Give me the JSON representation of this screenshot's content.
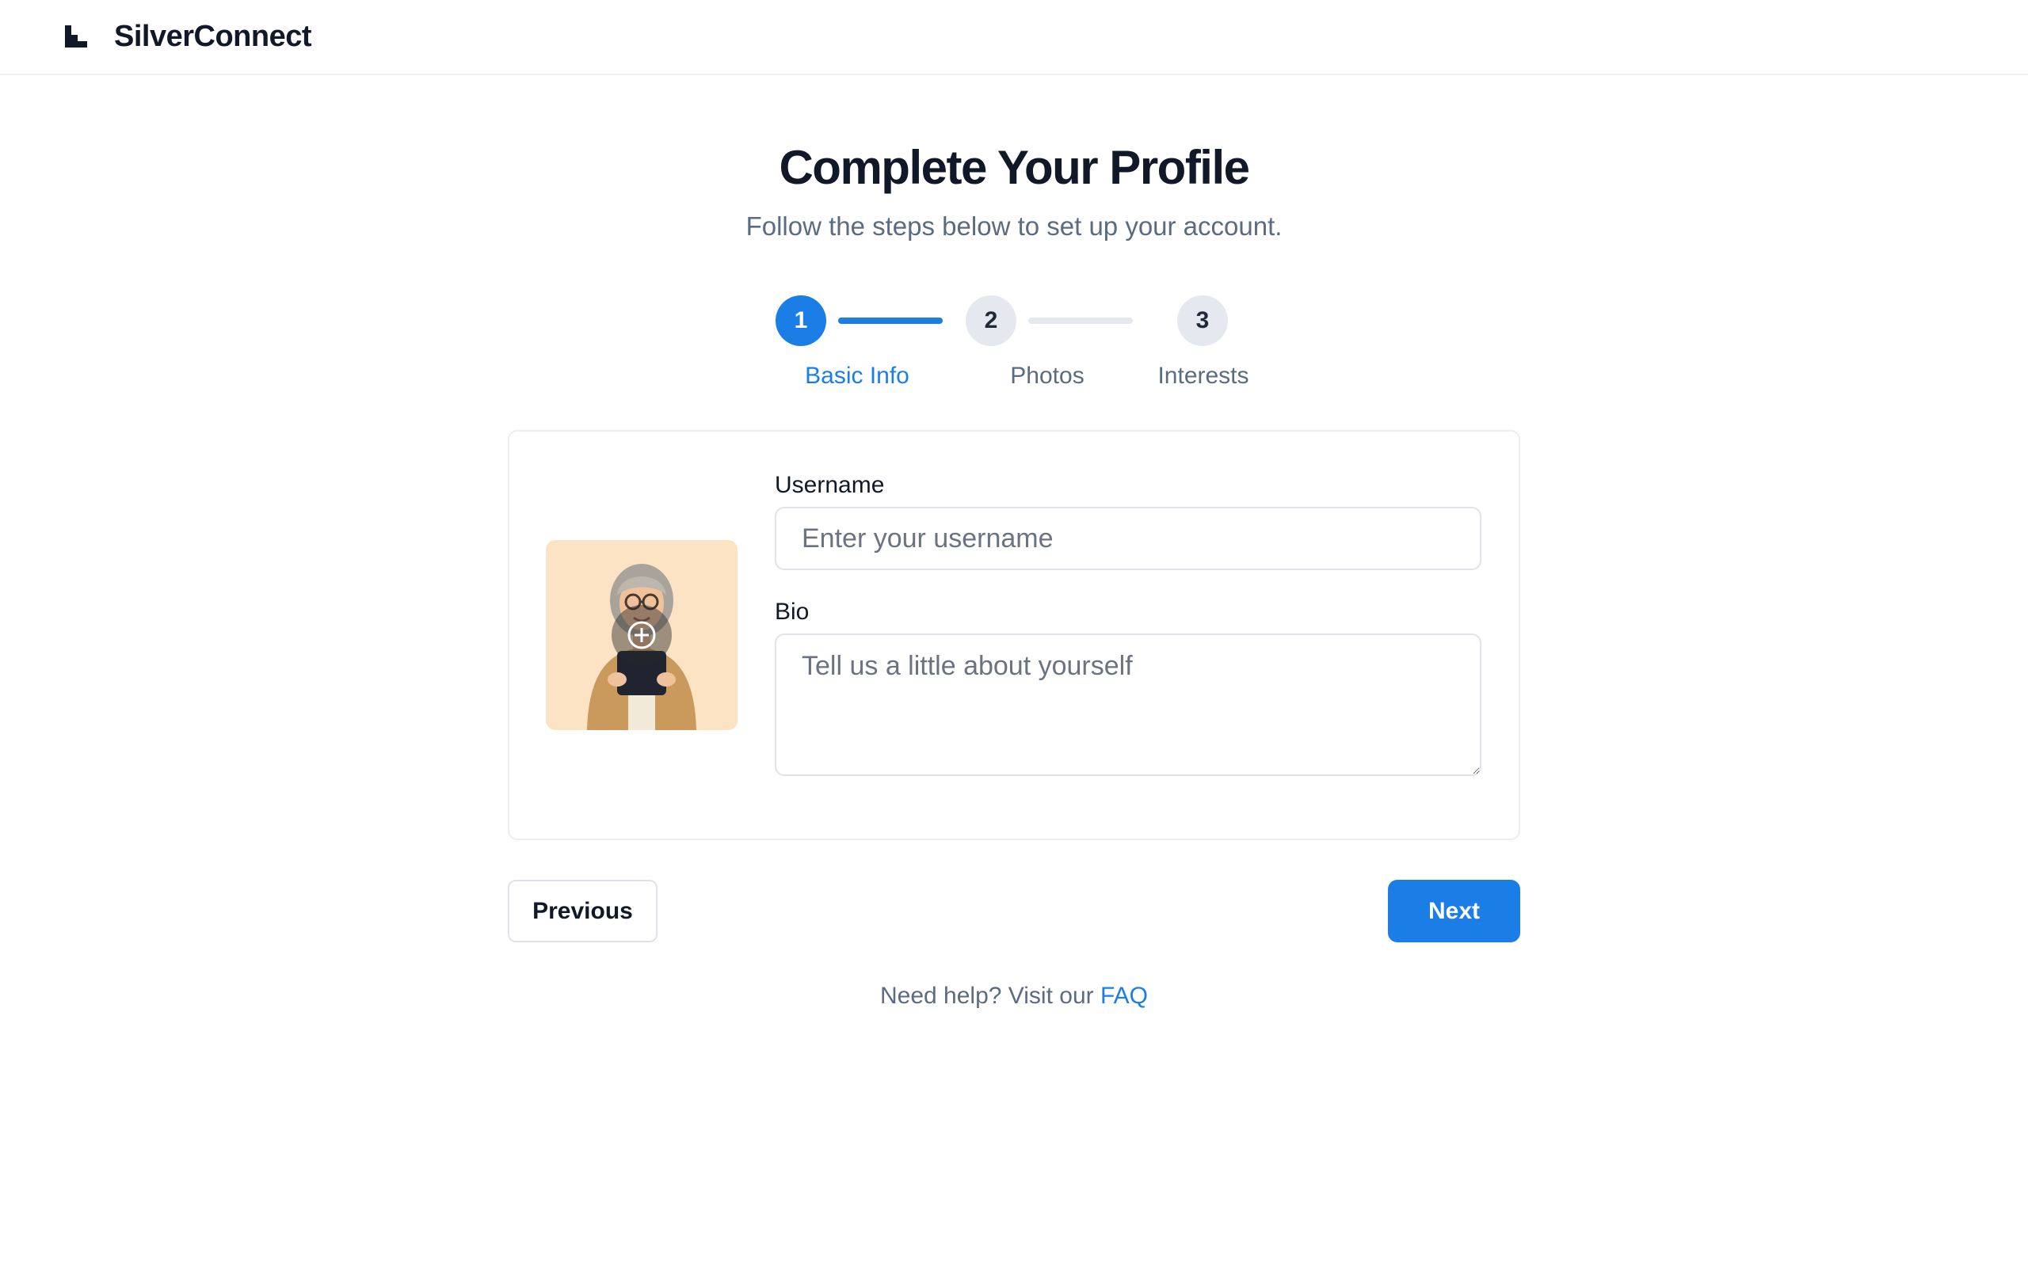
{
  "header": {
    "brand": "SilverConnect",
    "logo_icon": "brand-logo-icon"
  },
  "page": {
    "title": "Complete Your Profile",
    "subtitle": "Follow the steps below to set up your account."
  },
  "stepper": {
    "current_step": 1,
    "steps": [
      {
        "number": "1",
        "label": "Basic Info",
        "state": "active"
      },
      {
        "number": "2",
        "label": "Photos",
        "state": "upcoming"
      },
      {
        "number": "3",
        "label": "Interests",
        "state": "upcoming"
      }
    ]
  },
  "form": {
    "avatar_icon": "add-photo-icon",
    "username_label": "Username",
    "username_placeholder": "Enter your username",
    "username_value": "",
    "bio_label": "Bio",
    "bio_placeholder": "Tell us a little about yourself",
    "bio_value": ""
  },
  "actions": {
    "previous_label": "Previous",
    "next_label": "Next"
  },
  "help": {
    "text": "Need help? Visit our ",
    "link_label": "FAQ"
  },
  "colors": {
    "accent": "#1a7ee6",
    "muted_text": "#5b6b82",
    "idle_step": "#e5e8ee",
    "avatar_bg": "#fbe3c4"
  }
}
